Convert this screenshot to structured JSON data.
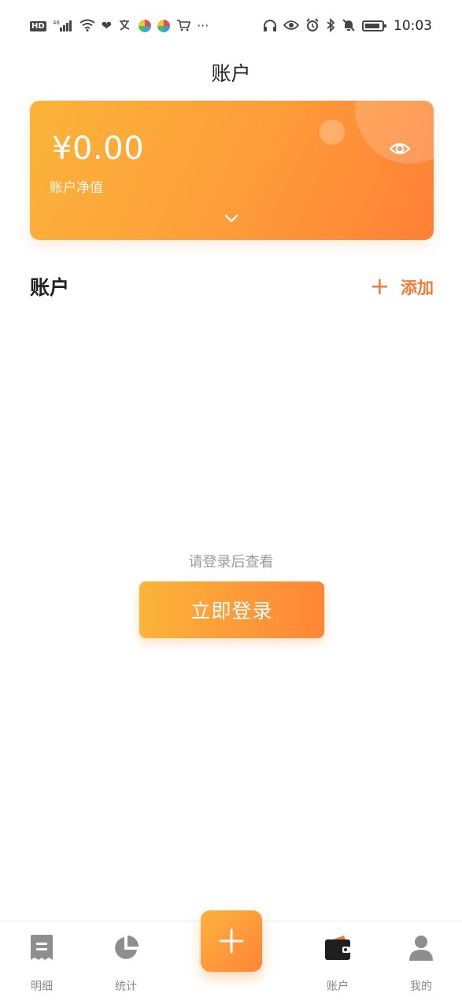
{
  "status_bar": {
    "left_badge": "HD",
    "signal": "46",
    "more": "···",
    "time": "10:03"
  },
  "header": {
    "title": "账户"
  },
  "balance_card": {
    "amount": "¥0.00",
    "label": "账户净值",
    "icons": [
      "eye-icon",
      "chevron-down-icon"
    ]
  },
  "accounts_section": {
    "title": "账户",
    "add_label": "添加"
  },
  "empty_state": {
    "hint": "请登录后查看",
    "login_label": "立即登录"
  },
  "tabbar": {
    "items": [
      {
        "label": "明细",
        "icon": "receipt-icon"
      },
      {
        "label": "统计",
        "icon": "pie-chart-icon"
      },
      {
        "label": "账户",
        "icon": "wallet-icon",
        "active": true
      },
      {
        "label": "我的",
        "icon": "person-icon"
      }
    ],
    "fab_icon": "plus-icon"
  },
  "colors": {
    "accent": "#ff8636",
    "accent_light": "#fbb43a",
    "add_text": "#f07a36",
    "muted_text": "#9a9a9a"
  }
}
